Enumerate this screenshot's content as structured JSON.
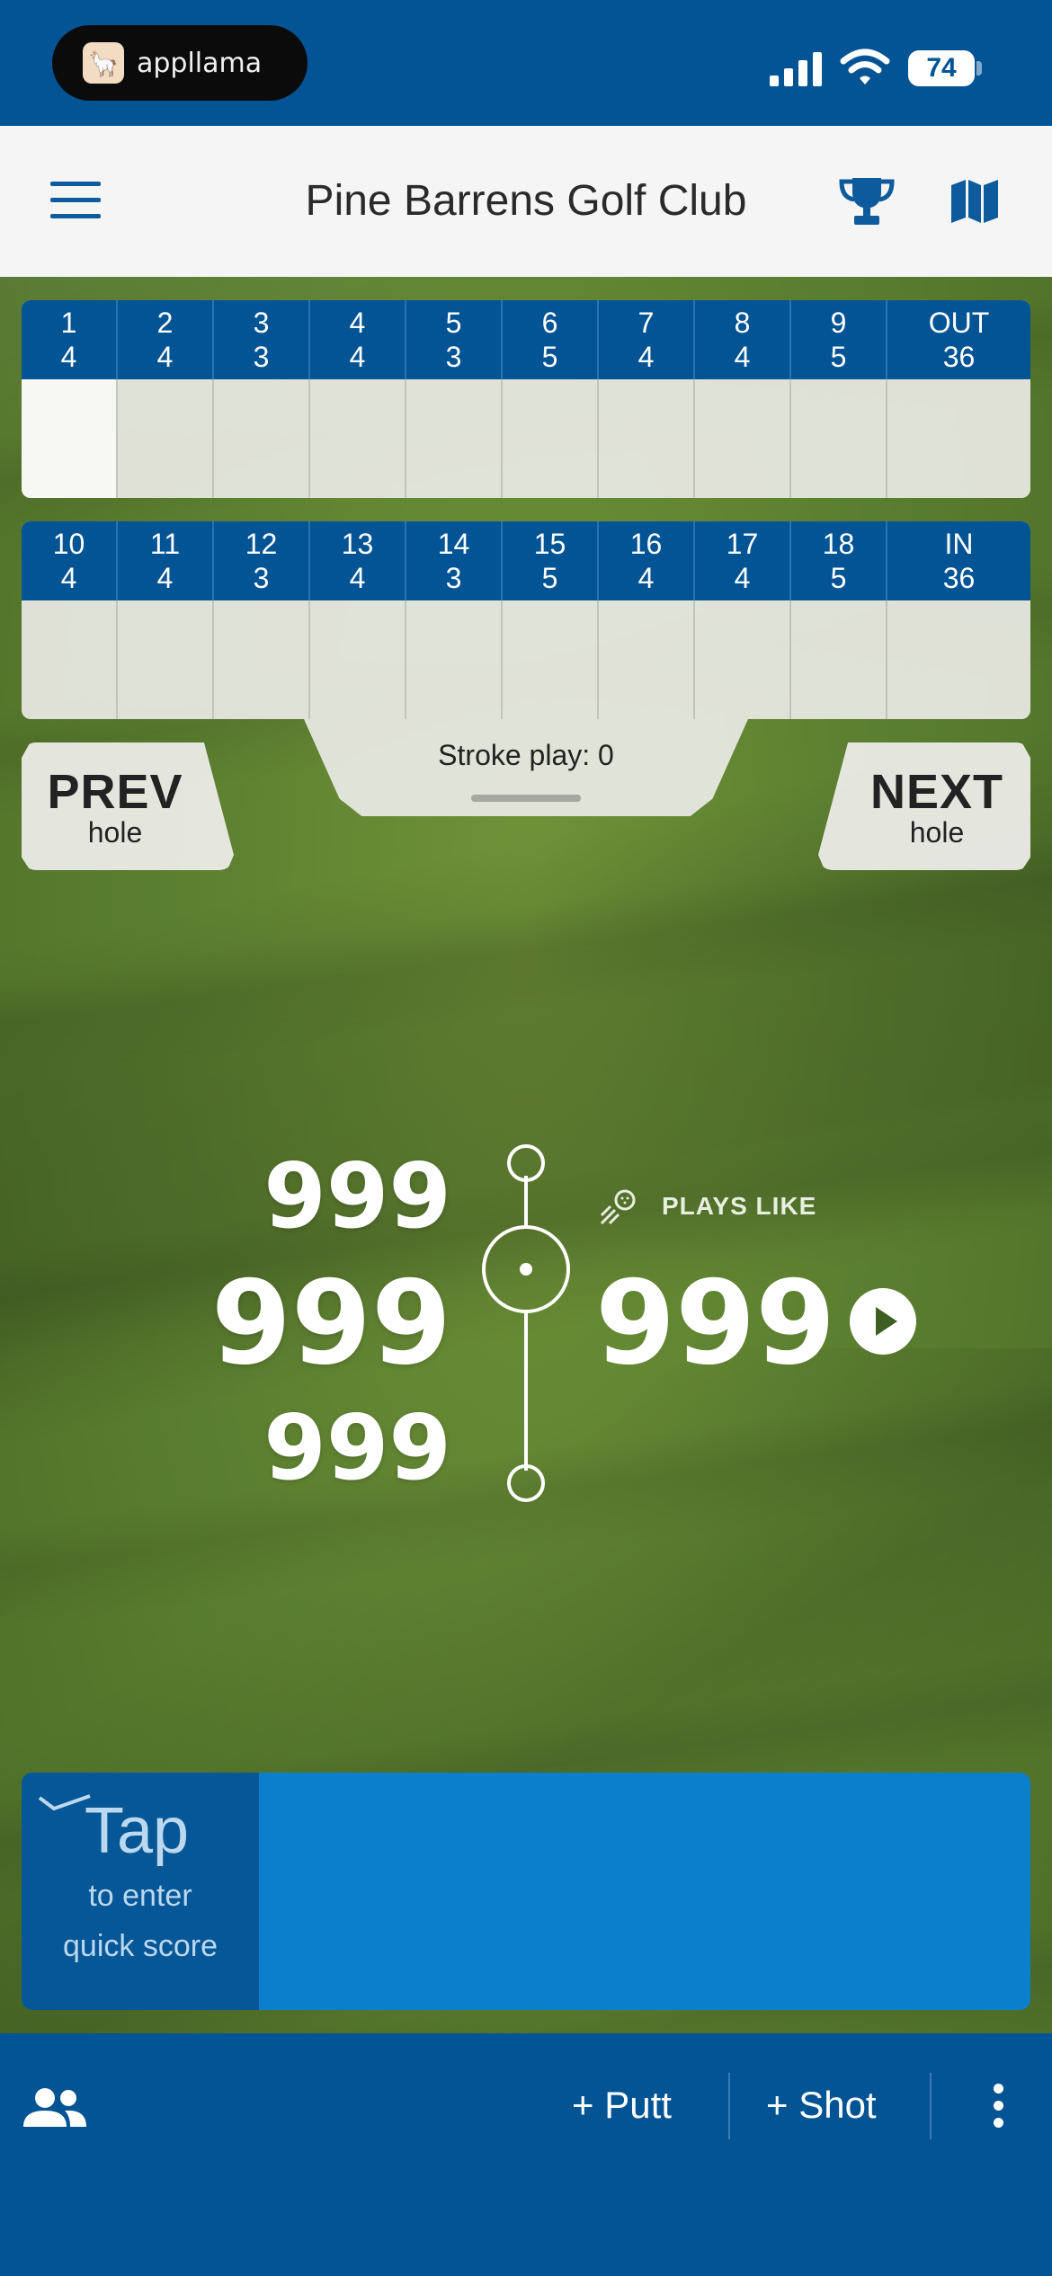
{
  "status_bar": {
    "app_badge": "appllama",
    "battery": "74"
  },
  "header": {
    "title": "Pine Barrens Golf Club"
  },
  "scorecard": {
    "front": [
      {
        "hole": "1",
        "par": "4"
      },
      {
        "hole": "2",
        "par": "4"
      },
      {
        "hole": "3",
        "par": "3"
      },
      {
        "hole": "4",
        "par": "4"
      },
      {
        "hole": "5",
        "par": "3"
      },
      {
        "hole": "6",
        "par": "5"
      },
      {
        "hole": "7",
        "par": "4"
      },
      {
        "hole": "8",
        "par": "4"
      },
      {
        "hole": "9",
        "par": "5"
      }
    ],
    "out": {
      "label": "OUT",
      "par": "36"
    },
    "back": [
      {
        "hole": "10",
        "par": "4"
      },
      {
        "hole": "11",
        "par": "4"
      },
      {
        "hole": "12",
        "par": "3"
      },
      {
        "hole": "13",
        "par": "4"
      },
      {
        "hole": "14",
        "par": "3"
      },
      {
        "hole": "15",
        "par": "5"
      },
      {
        "hole": "16",
        "par": "4"
      },
      {
        "hole": "17",
        "par": "4"
      },
      {
        "hole": "18",
        "par": "5"
      }
    ],
    "in": {
      "label": "IN",
      "par": "36"
    },
    "current_hole": "1"
  },
  "stroke_play": "Stroke play: 0",
  "nav": {
    "prev_big": "PREV",
    "prev_small": "hole",
    "next_big": "NEXT",
    "next_small": "hole"
  },
  "distances": {
    "back": "999",
    "middle": "999",
    "front": "999",
    "plays_like_label": "PLAYS LIKE",
    "plays_like": "999"
  },
  "quick_score": {
    "tap": "Tap",
    "line1": "to enter",
    "line2": "quick score"
  },
  "bottom_bar": {
    "putt": "+ Putt",
    "shot": "+ Shot"
  },
  "colors": {
    "brand_blue": "#035494",
    "quick_score_blue": "#0c7fcc"
  },
  "icons": [
    "menu-icon",
    "trophy-icon",
    "map-icon",
    "golf-shot-icon",
    "play-icon",
    "people-icon",
    "more-vertical-icon",
    "signal-icon",
    "wifi-icon"
  ]
}
